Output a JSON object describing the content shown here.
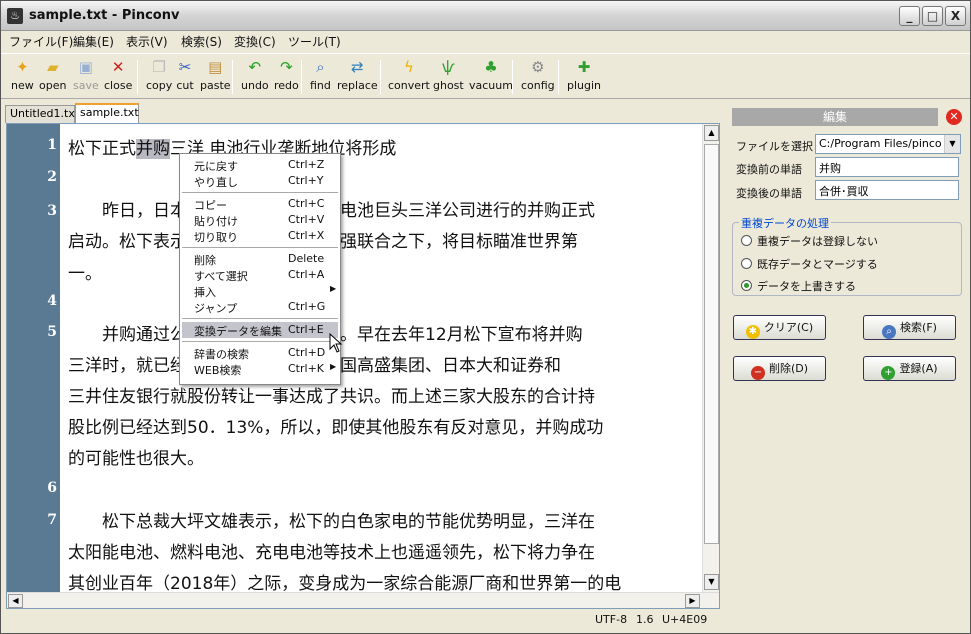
{
  "window": {
    "title": "sample.txt - Pinconv",
    "min": "_",
    "max": "□",
    "close": "X"
  },
  "menubar": [
    "ファイル(F)",
    "編集(E)",
    "表示(V)",
    "検索(S)",
    "変換(C)",
    "ツール(T)"
  ],
  "toolbar": [
    {
      "label": "new",
      "icon": "new-file-icon",
      "glyph": "✦",
      "color": "#e8a020"
    },
    {
      "label": "open",
      "icon": "open-folder-icon",
      "glyph": "▰",
      "color": "#e0b030"
    },
    {
      "label": "save",
      "icon": "save-disk-icon",
      "glyph": "▣",
      "color": "#9ab0d0",
      "disabled": true
    },
    {
      "label": "close",
      "icon": "close-x-icon",
      "glyph": "✕",
      "color": "#d02020"
    },
    {
      "label": "copy",
      "icon": "copy-icon",
      "glyph": "❐",
      "color": "#bbbbbb"
    },
    {
      "label": "cut",
      "icon": "scissors-icon",
      "glyph": "✂",
      "color": "#3060c0"
    },
    {
      "label": "paste",
      "icon": "paste-clipboard-icon",
      "glyph": "▤",
      "color": "#c09040"
    },
    {
      "label": "undo",
      "icon": "undo-arrow-icon",
      "glyph": "↶",
      "color": "#20a020"
    },
    {
      "label": "redo",
      "icon": "redo-arrow-icon",
      "glyph": "↷",
      "color": "#20a020"
    },
    {
      "label": "find",
      "icon": "find-magnifier-icon",
      "glyph": "⌕",
      "color": "#4070c0"
    },
    {
      "label": "replace",
      "icon": "replace-icon",
      "glyph": "⇄",
      "color": "#3080c0"
    },
    {
      "label": "convert",
      "icon": "convert-lightning-icon",
      "glyph": "ϟ",
      "color": "#f0b000"
    },
    {
      "label": "ghost",
      "icon": "ghost-icon",
      "glyph": "ѱ",
      "color": "#30a030"
    },
    {
      "label": "vacuum",
      "icon": "vacuum-icon",
      "glyph": "♣",
      "color": "#30a030"
    },
    {
      "label": "config",
      "icon": "config-gear-icon",
      "glyph": "⚙",
      "color": "#888888"
    },
    {
      "label": "plugin",
      "icon": "plugin-puzzle-icon",
      "glyph": "✚",
      "color": "#30a030"
    }
  ],
  "tabs": [
    "Untitled1.txt",
    "sample.txt"
  ],
  "editor": {
    "line_numbers": [
      "1",
      "2",
      "3",
      "4",
      "5",
      "6",
      "7"
    ],
    "lines": [
      {
        "pre": "松下正式",
        "hl": "并购",
        "post": "三洋 电池行业垄断地位将形成"
      },
      {
        "text": "　　昨日，日本家电巨头松下公司对电池巨头三洋公司进行的并购正式"
      },
      {
        "text": "启动。松下表示，有充分的把握，强强联合之下，将目标瞄准世界第"
      },
      {
        "text": "一。"
      },
      {
        "text": "　　并购通过公开收购方式正式进行。早在去年12月松下宣布将并购"
      },
      {
        "text": "三洋时，就已经与三洋的股东——美国高盛集团、日本大和证券和"
      },
      {
        "text": "三井住友银行就股份转让一事达成了共识。而上述三家大股东的合计持"
      },
      {
        "text": "股比例已经达到50．13%，所以，即使其他股东有反对意见，并购成功"
      },
      {
        "text": "的可能性也很大。"
      },
      {
        "text": "　　松下总裁大坪文雄表示，松下的白色家电的节能优势明显，三洋在"
      },
      {
        "text": "太阳能电池、燃料电池、充电电池等技术上也遥遥领先，松下将力争在"
      },
      {
        "text": "其创业百年（2018年）之际，变身成为一家综合能源厂商和世界第一的电"
      }
    ]
  },
  "context_menu": {
    "items": [
      {
        "label": "元に戻す",
        "shortcut": "Ctrl+Z"
      },
      {
        "label": "やり直し",
        "shortcut": "Ctrl+Y"
      },
      {
        "sep": true
      },
      {
        "label": "コピー",
        "shortcut": "Ctrl+C"
      },
      {
        "label": "貼り付け",
        "shortcut": "Ctrl+V"
      },
      {
        "label": "切り取り",
        "shortcut": "Ctrl+X"
      },
      {
        "sep": true
      },
      {
        "label": "削除",
        "shortcut": "Delete"
      },
      {
        "label": "すべて選択",
        "shortcut": "Ctrl+A"
      },
      {
        "label": "挿入",
        "shortcut": "",
        "submenu": true
      },
      {
        "label": "ジャンプ",
        "shortcut": "Ctrl+G"
      },
      {
        "sep": true
      },
      {
        "label": "変換データを編集",
        "shortcut": "Ctrl+E",
        "selected": true
      },
      {
        "sep": true
      },
      {
        "label": "辞書の検索",
        "shortcut": "Ctrl+D"
      },
      {
        "label": "WEB検索",
        "shortcut": "Ctrl+K",
        "submenu": true
      }
    ],
    "submenu_glyph": "▶"
  },
  "status": {
    "encoding": "UTF-8",
    "position": "1.6",
    "codepoint": "U+4E09"
  },
  "panel": {
    "title": "編集",
    "close_glyph": "✕",
    "file_label": "ファイルを選択",
    "file_value": "C:/Program Files/pinco",
    "before_label": "変換前の単語",
    "before_value": "并购",
    "after_label": "変換後の単語",
    "after_value": "合併･買収",
    "group_title": "重複データの処理",
    "options": [
      "重複データは登録しない",
      "既存データとマージする",
      "データを上書きする"
    ],
    "selected_option": 2,
    "buttons": {
      "clear": "クリア(C)",
      "search": "検索(F)",
      "delete": "削除(D)",
      "register": "登録(A)"
    },
    "dropdown_glyph": "▼"
  }
}
